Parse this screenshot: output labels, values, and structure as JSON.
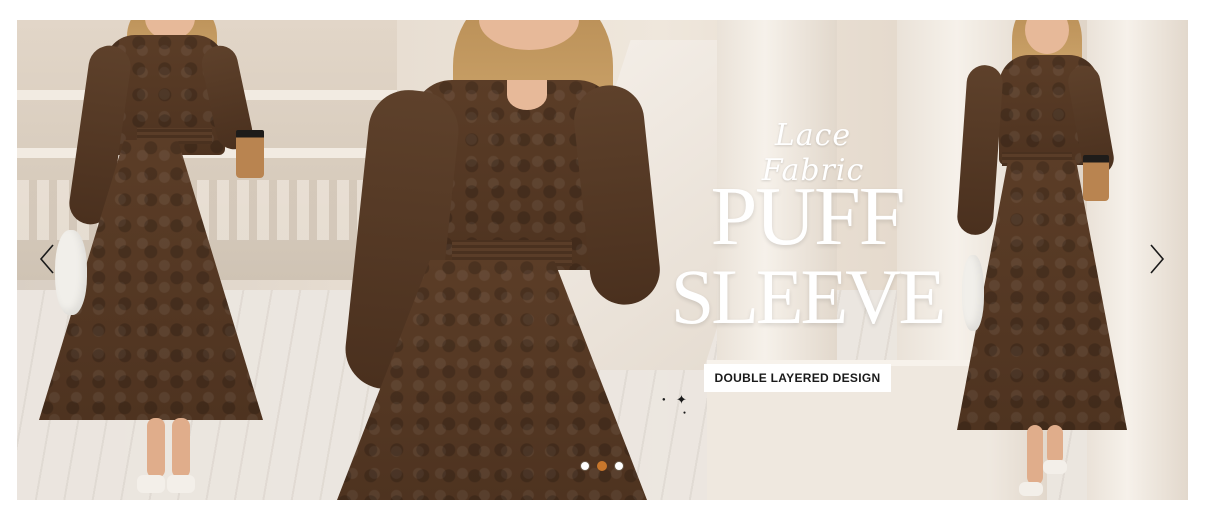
{
  "banner": {
    "script_title": "Lace Fabric",
    "title_line1": "PUFF",
    "title_line2": "SLEEVE",
    "cta_label": "DOUBLE LAYERED DESIGN",
    "prev_icon": "chevron-left-icon",
    "next_icon": "chevron-right-icon",
    "slides": [
      {
        "active": false
      },
      {
        "active": true
      },
      {
        "active": false
      }
    ],
    "accent_color": "#c8772c"
  }
}
